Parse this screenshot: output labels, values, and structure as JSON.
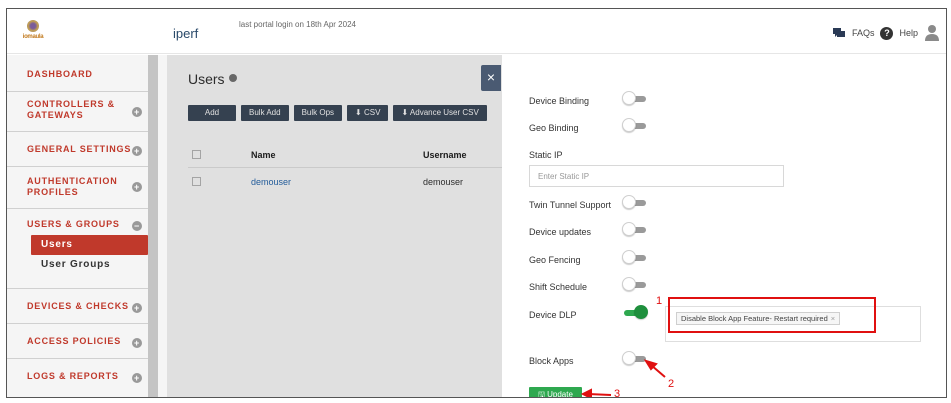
{
  "header": {
    "logo_text": "iomaula",
    "app_title": "iperf",
    "last_login": "last portal login on 18th Apr 2024",
    "faqs_label": "FAQs",
    "help_label": "Help"
  },
  "sidebar": {
    "items": [
      {
        "label": "DASHBOARD"
      },
      {
        "label": "CONTROLLERS & GATEWAYS"
      },
      {
        "label": "GENERAL SETTINGS"
      },
      {
        "label": "AUTHENTICATION PROFILES"
      },
      {
        "label": "USERS & GROUPS"
      },
      {
        "label": "DEVICES & CHECKS"
      },
      {
        "label": "ACCESS POLICIES"
      },
      {
        "label": "LOGS & REPORTS"
      }
    ],
    "sub_items": [
      {
        "label": "Users"
      },
      {
        "label": "User Groups"
      }
    ]
  },
  "main": {
    "title": "Users",
    "buttons": [
      {
        "label": "Add"
      },
      {
        "label": "Bulk Add"
      },
      {
        "label": "Bulk Ops"
      },
      {
        "label": "CSV"
      },
      {
        "label": "Advance User CSV"
      }
    ],
    "table": {
      "headers": {
        "name": "Name",
        "username": "Username"
      },
      "rows": [
        {
          "name": "demouser",
          "username": "demouser"
        }
      ]
    },
    "close_label": "×"
  },
  "panel": {
    "fields": {
      "device_binding": "Device Binding",
      "geo_binding": "Geo Binding",
      "static_ip": "Static IP",
      "twin_tunnel": "Twin Tunnel Support",
      "device_updates": "Device updates",
      "geo_fencing": "Geo Fencing",
      "shift_schedule": "Shift Schedule",
      "device_dlp": "Device DLP",
      "block_apps": "Block Apps"
    },
    "static_ip_placeholder": "Enter Static IP",
    "dlp_tag": "Disable Block App Feature- Restart required",
    "dlp_tag_remove": "×",
    "update_label": "Update",
    "annotations": [
      "1",
      "2",
      "3"
    ],
    "annotation_color": "#e01010"
  },
  "colors": {
    "accent": "#c0392b",
    "button_dark": "#3d4a5c",
    "toggle_on": "#2ea84f"
  }
}
